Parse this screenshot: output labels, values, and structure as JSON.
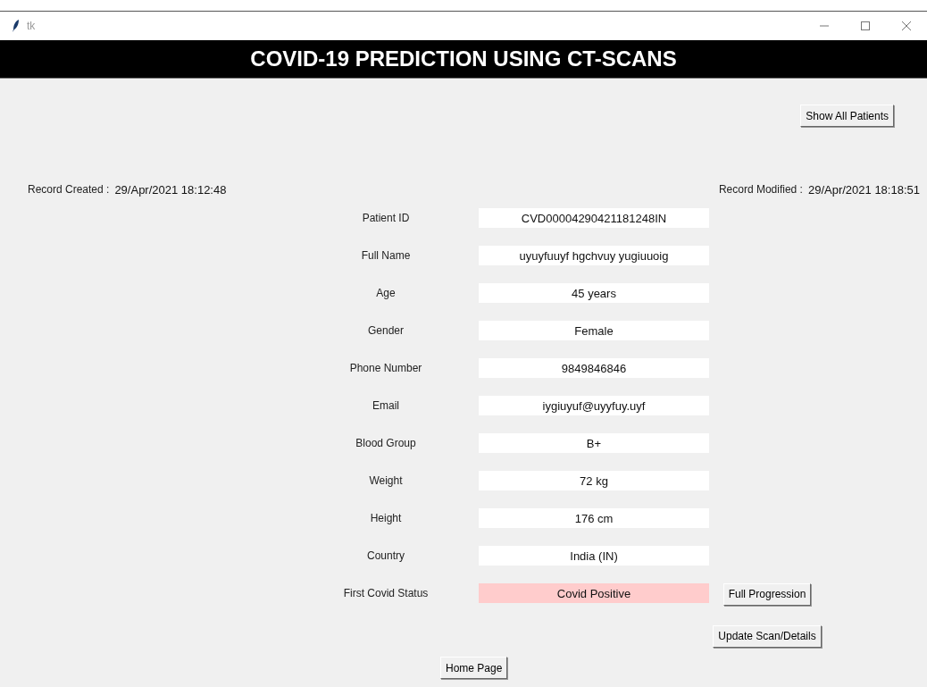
{
  "window": {
    "title": "tk"
  },
  "header": {
    "title": "COVID-19 PREDICTION USING CT-SCANS"
  },
  "top_button": "Show All Patients",
  "record_created": {
    "label": "Record Created :",
    "value": "29/Apr/2021 18:12:48"
  },
  "record_modified": {
    "label": "Record Modified :",
    "value": "29/Apr/2021 18:18:51"
  },
  "fields": [
    {
      "label": "Patient ID",
      "value": "CVD00004290421181248IN",
      "color": "#ffffff"
    },
    {
      "label": "Full Name",
      "value": "uyuyfuuyf hgchvuy yugiuuoig",
      "color": "#ffffff"
    },
    {
      "label": "Age",
      "value": "45 years",
      "color": "#ffffff"
    },
    {
      "label": "Gender",
      "value": "Female",
      "color": "#ffffff"
    },
    {
      "label": "Phone Number",
      "value": "9849846846",
      "color": "#ffffff"
    },
    {
      "label": "Email",
      "value": "iygiuyuf@uyyfuy.uyf",
      "color": "#ffffff"
    },
    {
      "label": "Blood Group",
      "value": "B+",
      "color": "#ffffff"
    },
    {
      "label": "Weight",
      "value": "72 kg",
      "color": "#ffffff"
    },
    {
      "label": "Height",
      "value": "176 cm",
      "color": "#ffffff"
    },
    {
      "label": "Country",
      "value": "India (IN)",
      "color": "#ffffff"
    },
    {
      "label": "First Covid Status",
      "value": "Covid Positive",
      "color": "#ffcccc"
    }
  ],
  "side_buttons": [
    "Full Progression",
    "Update Scan/Details"
  ],
  "bottom_button": "Home Page"
}
